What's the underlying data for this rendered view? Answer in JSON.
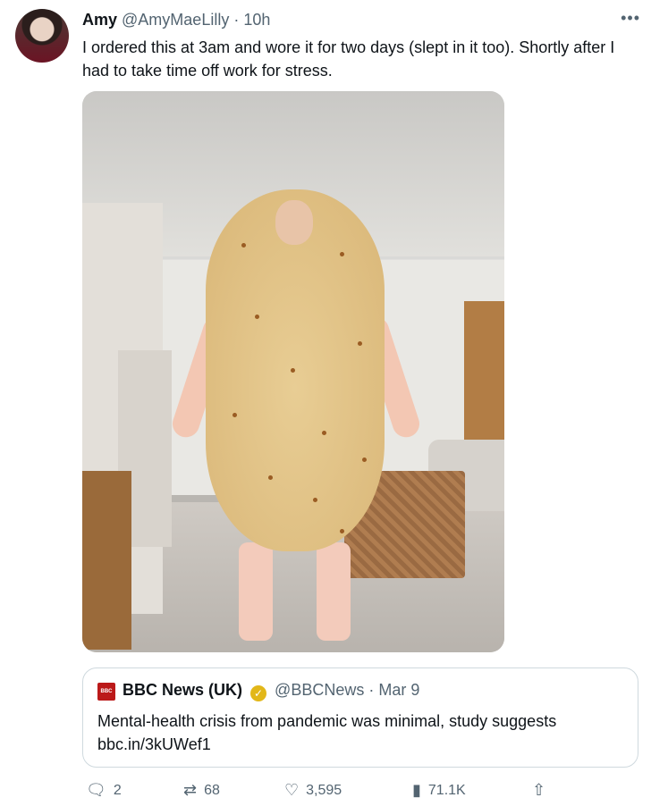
{
  "tweet": {
    "name": "Amy",
    "handle": "@AmyMaeLilly",
    "time": "10h",
    "text": "I ordered this at 3am and wore it for two days (slept in it too). Shortly after I had to take time off work for stress."
  },
  "quote": {
    "logo": "BBC NEWS",
    "name": "BBC News (UK)",
    "handle": "@BBCNews",
    "date": "Mar 9",
    "text": "Mental-health crisis from pandemic was minimal, study suggests",
    "link": "bbc.in/3kUWef1"
  },
  "actions": {
    "replies": "2",
    "retweets": "68",
    "likes": "3,595",
    "views": "71.1K"
  },
  "icons": {
    "more": "more-icon",
    "reply": "reply-icon",
    "retweet": "retweet-icon",
    "like": "heart-icon",
    "views": "views-icon",
    "share": "share-icon"
  }
}
